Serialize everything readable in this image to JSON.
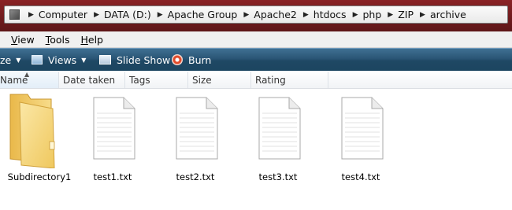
{
  "address_bar": {
    "breadcrumbs": [
      "Computer",
      "DATA (D:)",
      "Apache Group",
      "Apache2",
      "htdocs",
      "php",
      "ZIP",
      "archive"
    ],
    "separator_icon": "chevron-right-icon"
  },
  "menu": {
    "items": [
      {
        "label": "View",
        "access_key": "V"
      },
      {
        "label": "Tools",
        "access_key": "T"
      },
      {
        "label": "Help",
        "access_key": "H"
      }
    ]
  },
  "toolbar": {
    "organize_partial": "ze",
    "views_label": "Views",
    "slideshow_label": "Slide Show",
    "burn_label": "Burn"
  },
  "columns": [
    "Name",
    "Date taken",
    "Tags",
    "Size",
    "Rating"
  ],
  "files": [
    {
      "name": "Subdirectory1",
      "type": "folder"
    },
    {
      "name": "test1.txt",
      "type": "text"
    },
    {
      "name": "test2.txt",
      "type": "text"
    },
    {
      "name": "test3.txt",
      "type": "text"
    },
    {
      "name": "test4.txt",
      "type": "text"
    }
  ],
  "colors": {
    "title_band": "#6e1b1d",
    "toolbar": "#2a5575",
    "folder": "#f2d27a"
  }
}
